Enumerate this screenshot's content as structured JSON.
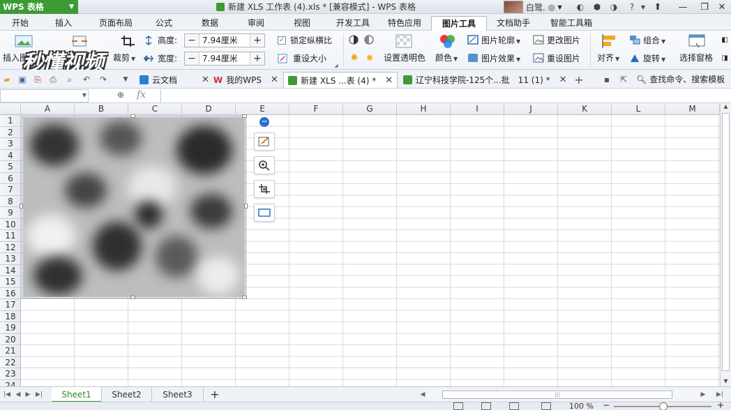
{
  "app": {
    "logo_label": "WPS 表格",
    "window_title": "新建 XLS 工作表 (4).xls * [兼容模式] - WPS 表格",
    "user_name": "白鹭."
  },
  "menu_tabs": [
    "开始",
    "插入",
    "页面布局",
    "公式",
    "数据",
    "审阅",
    "视图",
    "开发工具",
    "特色应用",
    "图片工具",
    "文档助手",
    "智能工具箱"
  ],
  "active_menu_tab": "图片工具",
  "ribbon": {
    "insert_picture": "插入图片",
    "compress_picture": "压缩图片",
    "crop": "裁剪",
    "height_label": "高度:",
    "height_value": "7.94厘米",
    "width_label": "宽度:",
    "width_value": "7.94厘米",
    "lock_aspect": "锁定纵横比",
    "reset_size": "重设大小",
    "set_transparent": "设置透明色",
    "color": "颜色",
    "picture_outline": "图片轮廓",
    "picture_effects": "图片效果",
    "change_picture": "更改图片",
    "reset_picture": "重设图片",
    "align": "对齐",
    "group": "组合",
    "rotate": "旋转",
    "selection_pane": "选择窗格"
  },
  "watermark_text": "秒懂视频",
  "doc_tabs": [
    {
      "label": "云文档"
    },
    {
      "label": "我的WPS"
    },
    {
      "label": "新建 XLS ...表 (4) *"
    },
    {
      "label": "辽宁科技学院-125个...批　11 (1) *"
    }
  ],
  "search_placeholder": "查找命令、搜索模板",
  "formula_bar": {
    "fx_label": "fx"
  },
  "columns": [
    "A",
    "B",
    "C",
    "D",
    "E",
    "F",
    "G",
    "H",
    "I",
    "J",
    "K",
    "L",
    "M"
  ],
  "rows": [
    "1",
    "2",
    "3",
    "4",
    "5",
    "6",
    "7",
    "8",
    "9",
    "10",
    "11",
    "12",
    "13",
    "14",
    "15",
    "16",
    "17",
    "18",
    "19",
    "20",
    "21",
    "22",
    "23",
    "24"
  ],
  "sheets": [
    "Sheet1",
    "Sheet2",
    "Sheet3"
  ],
  "active_sheet": "Sheet1",
  "status": {
    "zoom": "100 %"
  },
  "colors": {
    "wps_green": "#3d9b35",
    "active_tab_text": "#2a8a2a"
  }
}
